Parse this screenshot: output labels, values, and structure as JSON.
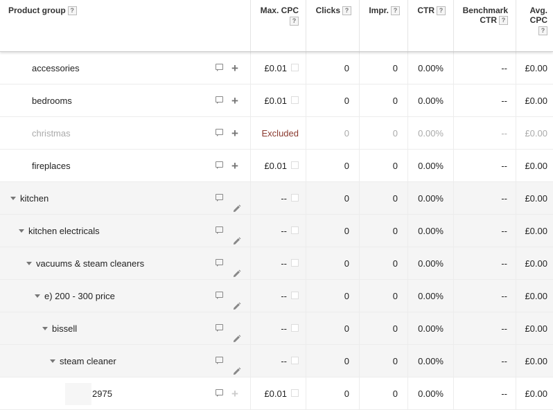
{
  "header": {
    "product_group": "Product group",
    "max_cpc": "Max. CPC",
    "clicks": "Clicks",
    "impr": "Impr.",
    "ctr": "CTR",
    "benchmark_line1": "Benchmark",
    "benchmark_line2": "CTR",
    "avg_line1": "Avg.",
    "avg_line2": "CPC",
    "help": "?"
  },
  "rows": [
    {
      "name": "accessories",
      "expand": false,
      "action": "plus",
      "max_cpc": "£0.01",
      "bid_checkbox": true,
      "clicks": "0",
      "impr": "0",
      "ctr": "0.00%",
      "benchmark": "--",
      "avg_cpc": "£0.00"
    },
    {
      "name": "bedrooms",
      "expand": false,
      "action": "plus",
      "max_cpc": "£0.01",
      "bid_checkbox": true,
      "clicks": "0",
      "impr": "0",
      "ctr": "0.00%",
      "benchmark": "--",
      "avg_cpc": "£0.00"
    },
    {
      "name": "christmas",
      "expand": false,
      "action": "plus",
      "max_cpc": "Excluded",
      "bid_checkbox": false,
      "excluded": true,
      "clicks": "0",
      "impr": "0",
      "ctr": "0.00%",
      "benchmark": "--",
      "avg_cpc": "£0.00"
    },
    {
      "name": "fireplaces",
      "expand": false,
      "action": "plus",
      "max_cpc": "£0.01",
      "bid_checkbox": true,
      "clicks": "0",
      "impr": "0",
      "ctr": "0.00%",
      "benchmark": "--",
      "avg_cpc": "£0.00"
    },
    {
      "name": "kitchen",
      "expand": true,
      "action": "edit",
      "max_cpc": "--",
      "bid_checkbox": true,
      "clicks": "0",
      "impr": "0",
      "ctr": "0.00%",
      "benchmark": "--",
      "avg_cpc": "£0.00"
    },
    {
      "name": "kitchen electricals",
      "expand": true,
      "action": "edit",
      "max_cpc": "--",
      "bid_checkbox": true,
      "clicks": "0",
      "impr": "0",
      "ctr": "0.00%",
      "benchmark": "--",
      "avg_cpc": "£0.00"
    },
    {
      "name": "vacuums & steam cleaners",
      "expand": true,
      "action": "edit",
      "max_cpc": "--",
      "bid_checkbox": true,
      "clicks": "0",
      "impr": "0",
      "ctr": "0.00%",
      "benchmark": "--",
      "avg_cpc": "£0.00"
    },
    {
      "name": "e) 200 - 300 price",
      "expand": true,
      "action": "edit",
      "max_cpc": "--",
      "bid_checkbox": true,
      "clicks": "0",
      "impr": "0",
      "ctr": "0.00%",
      "benchmark": "--",
      "avg_cpc": "£0.00"
    },
    {
      "name": "bissell",
      "expand": true,
      "action": "edit",
      "max_cpc": "--",
      "bid_checkbox": true,
      "clicks": "0",
      "impr": "0",
      "ctr": "0.00%",
      "benchmark": "--",
      "avg_cpc": "£0.00"
    },
    {
      "name": "steam cleaner",
      "expand": true,
      "action": "edit",
      "max_cpc": "--",
      "bid_checkbox": true,
      "clicks": "0",
      "impr": "0",
      "ctr": "0.00%",
      "benchmark": "--",
      "avg_cpc": "£0.00"
    },
    {
      "name": "2975",
      "expand": false,
      "action": "plus-disabled",
      "max_cpc": "£0.01",
      "bid_checkbox": true,
      "clicks": "0",
      "impr": "0",
      "ctr": "0.00%",
      "benchmark": "--",
      "avg_cpc": "£0.00"
    }
  ]
}
